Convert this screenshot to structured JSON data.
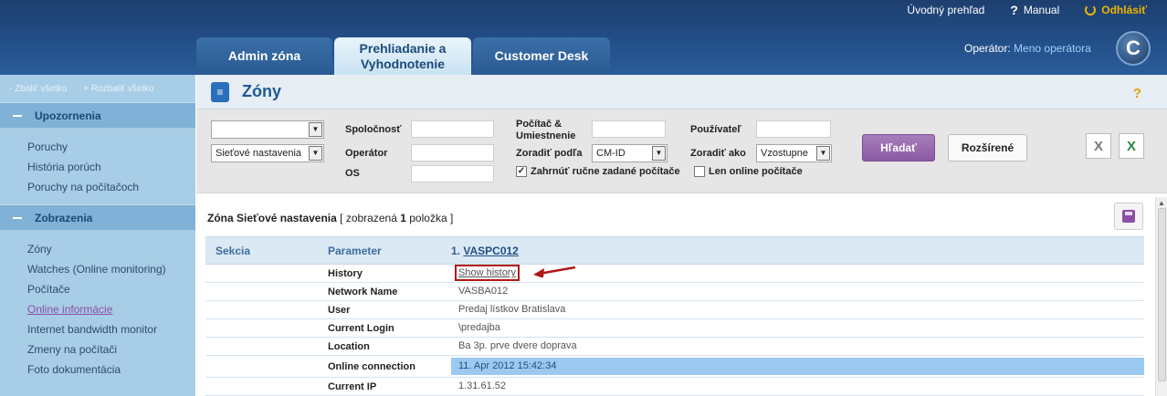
{
  "topbar": {
    "overview": "Úvodný prehľad",
    "manual": "Manual",
    "logout": "Odhlásiť"
  },
  "tabs": [
    {
      "label": "Admin zóna"
    },
    {
      "label": "Prehliadanie a Vyhodnotenie",
      "active": true
    },
    {
      "label": "Customer Desk"
    }
  ],
  "operator": {
    "label": "Operátor:",
    "name": "Meno operátora"
  },
  "sidebar": {
    "collapse_all": "Zbaliť všetko",
    "expand_all": "Rozbaliť všetko",
    "sections": [
      {
        "title": "Upozornenia",
        "items": [
          "Poruchy",
          "História porúch",
          "Poruchy na počítačoch"
        ]
      },
      {
        "title": "Zobrazenia",
        "items": [
          "Zóny",
          "Watches (Online monitoring)",
          "Počítače",
          "Online informácie",
          "Internet bandwidth monitor",
          "Zmeny na počítači",
          "Foto dokumentácia"
        ],
        "active_item": "Online informácie"
      }
    ]
  },
  "page": {
    "title": "Zóny",
    "help": "?"
  },
  "filters": {
    "select1_value": "",
    "select2_value": "Sieťové nastavenia",
    "company_label": "Spoločnosť",
    "operator_label": "Operátor",
    "os_label": "OS",
    "computer_label": "Počítač & Umiestnenie",
    "sort_by_label": "Zoradiť podľa",
    "sort_by_value": "CM-ID",
    "user_label": "Používateľ",
    "sort_order_label": "Zoradiť ako",
    "sort_order_value": "Vzostupne",
    "include_manual_label": "Zahrnúť ručne zadané počítače",
    "include_manual_checked": true,
    "online_only_label": "Len online počítače",
    "online_only_checked": false,
    "search_button": "Hľadať",
    "advanced_button": "Rozšírené"
  },
  "result": {
    "zone_text": "Zóna Sieťové nastavenia",
    "shown_prefix": "[ zobrazená",
    "count": "1",
    "shown_suffix": "položka ]"
  },
  "table": {
    "headers": {
      "section": "Sekcia",
      "parameter": "Parameter",
      "computer_index": "1.",
      "computer": "VASPC012"
    },
    "rows": [
      {
        "param": "History",
        "value": "Show history"
      },
      {
        "param": "Network Name",
        "value": "VASBA012"
      },
      {
        "param": "User",
        "value": "Predaj lístkov Bratislava"
      },
      {
        "param": "Current Login",
        "value": "\\predajba"
      },
      {
        "param": "Location",
        "value": "Ba 3p. prve dvere doprava"
      },
      {
        "param": "Online connection",
        "value": "11. Apr 2012 15:42:34"
      },
      {
        "param": "Current IP",
        "value": "1.31.61.52"
      }
    ]
  },
  "colors": {
    "accent": "#8a5aa2",
    "header": "#23508a",
    "highlight": "#9cc9ef",
    "callout": "#b01818"
  }
}
